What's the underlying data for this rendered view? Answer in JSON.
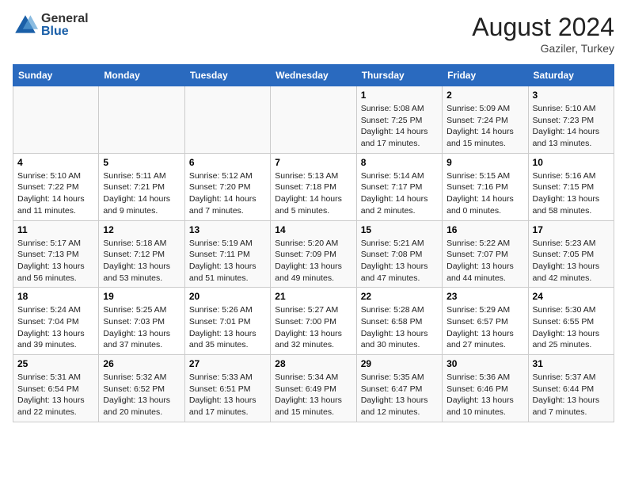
{
  "header": {
    "logo_general": "General",
    "logo_blue": "Blue",
    "month_year": "August 2024",
    "location": "Gaziler, Turkey"
  },
  "weekdays": [
    "Sunday",
    "Monday",
    "Tuesday",
    "Wednesday",
    "Thursday",
    "Friday",
    "Saturday"
  ],
  "weeks": [
    [
      {
        "day": "",
        "info": ""
      },
      {
        "day": "",
        "info": ""
      },
      {
        "day": "",
        "info": ""
      },
      {
        "day": "",
        "info": ""
      },
      {
        "day": "1",
        "info": "Sunrise: 5:08 AM\nSunset: 7:25 PM\nDaylight: 14 hours and 17 minutes."
      },
      {
        "day": "2",
        "info": "Sunrise: 5:09 AM\nSunset: 7:24 PM\nDaylight: 14 hours and 15 minutes."
      },
      {
        "day": "3",
        "info": "Sunrise: 5:10 AM\nSunset: 7:23 PM\nDaylight: 14 hours and 13 minutes."
      }
    ],
    [
      {
        "day": "4",
        "info": "Sunrise: 5:10 AM\nSunset: 7:22 PM\nDaylight: 14 hours and 11 minutes."
      },
      {
        "day": "5",
        "info": "Sunrise: 5:11 AM\nSunset: 7:21 PM\nDaylight: 14 hours and 9 minutes."
      },
      {
        "day": "6",
        "info": "Sunrise: 5:12 AM\nSunset: 7:20 PM\nDaylight: 14 hours and 7 minutes."
      },
      {
        "day": "7",
        "info": "Sunrise: 5:13 AM\nSunset: 7:18 PM\nDaylight: 14 hours and 5 minutes."
      },
      {
        "day": "8",
        "info": "Sunrise: 5:14 AM\nSunset: 7:17 PM\nDaylight: 14 hours and 2 minutes."
      },
      {
        "day": "9",
        "info": "Sunrise: 5:15 AM\nSunset: 7:16 PM\nDaylight: 14 hours and 0 minutes."
      },
      {
        "day": "10",
        "info": "Sunrise: 5:16 AM\nSunset: 7:15 PM\nDaylight: 13 hours and 58 minutes."
      }
    ],
    [
      {
        "day": "11",
        "info": "Sunrise: 5:17 AM\nSunset: 7:13 PM\nDaylight: 13 hours and 56 minutes."
      },
      {
        "day": "12",
        "info": "Sunrise: 5:18 AM\nSunset: 7:12 PM\nDaylight: 13 hours and 53 minutes."
      },
      {
        "day": "13",
        "info": "Sunrise: 5:19 AM\nSunset: 7:11 PM\nDaylight: 13 hours and 51 minutes."
      },
      {
        "day": "14",
        "info": "Sunrise: 5:20 AM\nSunset: 7:09 PM\nDaylight: 13 hours and 49 minutes."
      },
      {
        "day": "15",
        "info": "Sunrise: 5:21 AM\nSunset: 7:08 PM\nDaylight: 13 hours and 47 minutes."
      },
      {
        "day": "16",
        "info": "Sunrise: 5:22 AM\nSunset: 7:07 PM\nDaylight: 13 hours and 44 minutes."
      },
      {
        "day": "17",
        "info": "Sunrise: 5:23 AM\nSunset: 7:05 PM\nDaylight: 13 hours and 42 minutes."
      }
    ],
    [
      {
        "day": "18",
        "info": "Sunrise: 5:24 AM\nSunset: 7:04 PM\nDaylight: 13 hours and 39 minutes."
      },
      {
        "day": "19",
        "info": "Sunrise: 5:25 AM\nSunset: 7:03 PM\nDaylight: 13 hours and 37 minutes."
      },
      {
        "day": "20",
        "info": "Sunrise: 5:26 AM\nSunset: 7:01 PM\nDaylight: 13 hours and 35 minutes."
      },
      {
        "day": "21",
        "info": "Sunrise: 5:27 AM\nSunset: 7:00 PM\nDaylight: 13 hours and 32 minutes."
      },
      {
        "day": "22",
        "info": "Sunrise: 5:28 AM\nSunset: 6:58 PM\nDaylight: 13 hours and 30 minutes."
      },
      {
        "day": "23",
        "info": "Sunrise: 5:29 AM\nSunset: 6:57 PM\nDaylight: 13 hours and 27 minutes."
      },
      {
        "day": "24",
        "info": "Sunrise: 5:30 AM\nSunset: 6:55 PM\nDaylight: 13 hours and 25 minutes."
      }
    ],
    [
      {
        "day": "25",
        "info": "Sunrise: 5:31 AM\nSunset: 6:54 PM\nDaylight: 13 hours and 22 minutes."
      },
      {
        "day": "26",
        "info": "Sunrise: 5:32 AM\nSunset: 6:52 PM\nDaylight: 13 hours and 20 minutes."
      },
      {
        "day": "27",
        "info": "Sunrise: 5:33 AM\nSunset: 6:51 PM\nDaylight: 13 hours and 17 minutes."
      },
      {
        "day": "28",
        "info": "Sunrise: 5:34 AM\nSunset: 6:49 PM\nDaylight: 13 hours and 15 minutes."
      },
      {
        "day": "29",
        "info": "Sunrise: 5:35 AM\nSunset: 6:47 PM\nDaylight: 13 hours and 12 minutes."
      },
      {
        "day": "30",
        "info": "Sunrise: 5:36 AM\nSunset: 6:46 PM\nDaylight: 13 hours and 10 minutes."
      },
      {
        "day": "31",
        "info": "Sunrise: 5:37 AM\nSunset: 6:44 PM\nDaylight: 13 hours and 7 minutes."
      }
    ]
  ]
}
